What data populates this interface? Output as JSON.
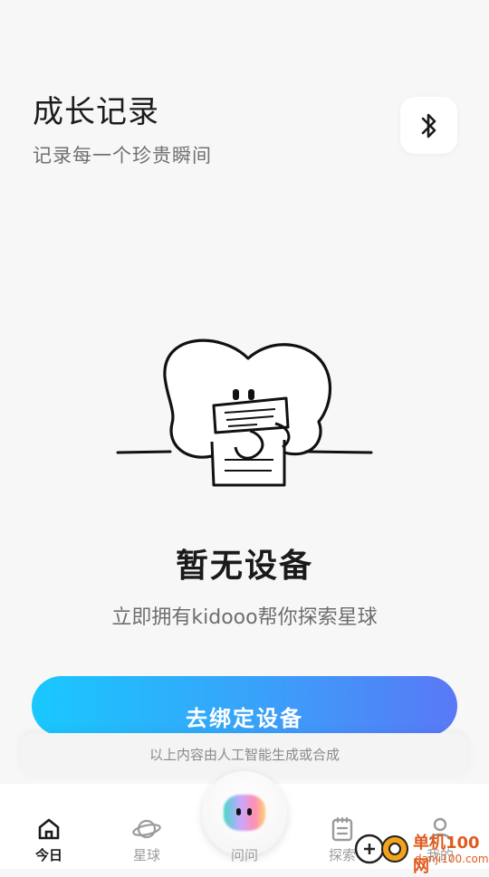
{
  "header": {
    "title": "成长记录",
    "subtitle": "记录每一个珍贵瞬间",
    "bluetooth_icon": "bluetooth-icon"
  },
  "empty_state": {
    "title": "暂无设备",
    "description": "立即拥有kidooo帮你探索星球",
    "illustration": "heart-character-holding-note"
  },
  "bind_button": {
    "label": "去绑定设备",
    "gradient": [
      "#19c8fd",
      "#5a78f6"
    ]
  },
  "ai_notice": "以上内容由人工智能生成或合成",
  "tab_bar": {
    "tabs": [
      {
        "label": "今日",
        "icon": "home-icon",
        "active": true
      },
      {
        "label": "星球",
        "icon": "planet-icon",
        "active": false
      },
      {
        "label": "问问",
        "icon": "ai-assistant-icon",
        "active": false
      },
      {
        "label": "探索",
        "icon": "notebook-icon",
        "active": false
      },
      {
        "label": "我的",
        "icon": "user-icon",
        "active": false
      }
    ]
  },
  "watermark": {
    "line1": "单机100网",
    "line2": "danji100.com"
  }
}
